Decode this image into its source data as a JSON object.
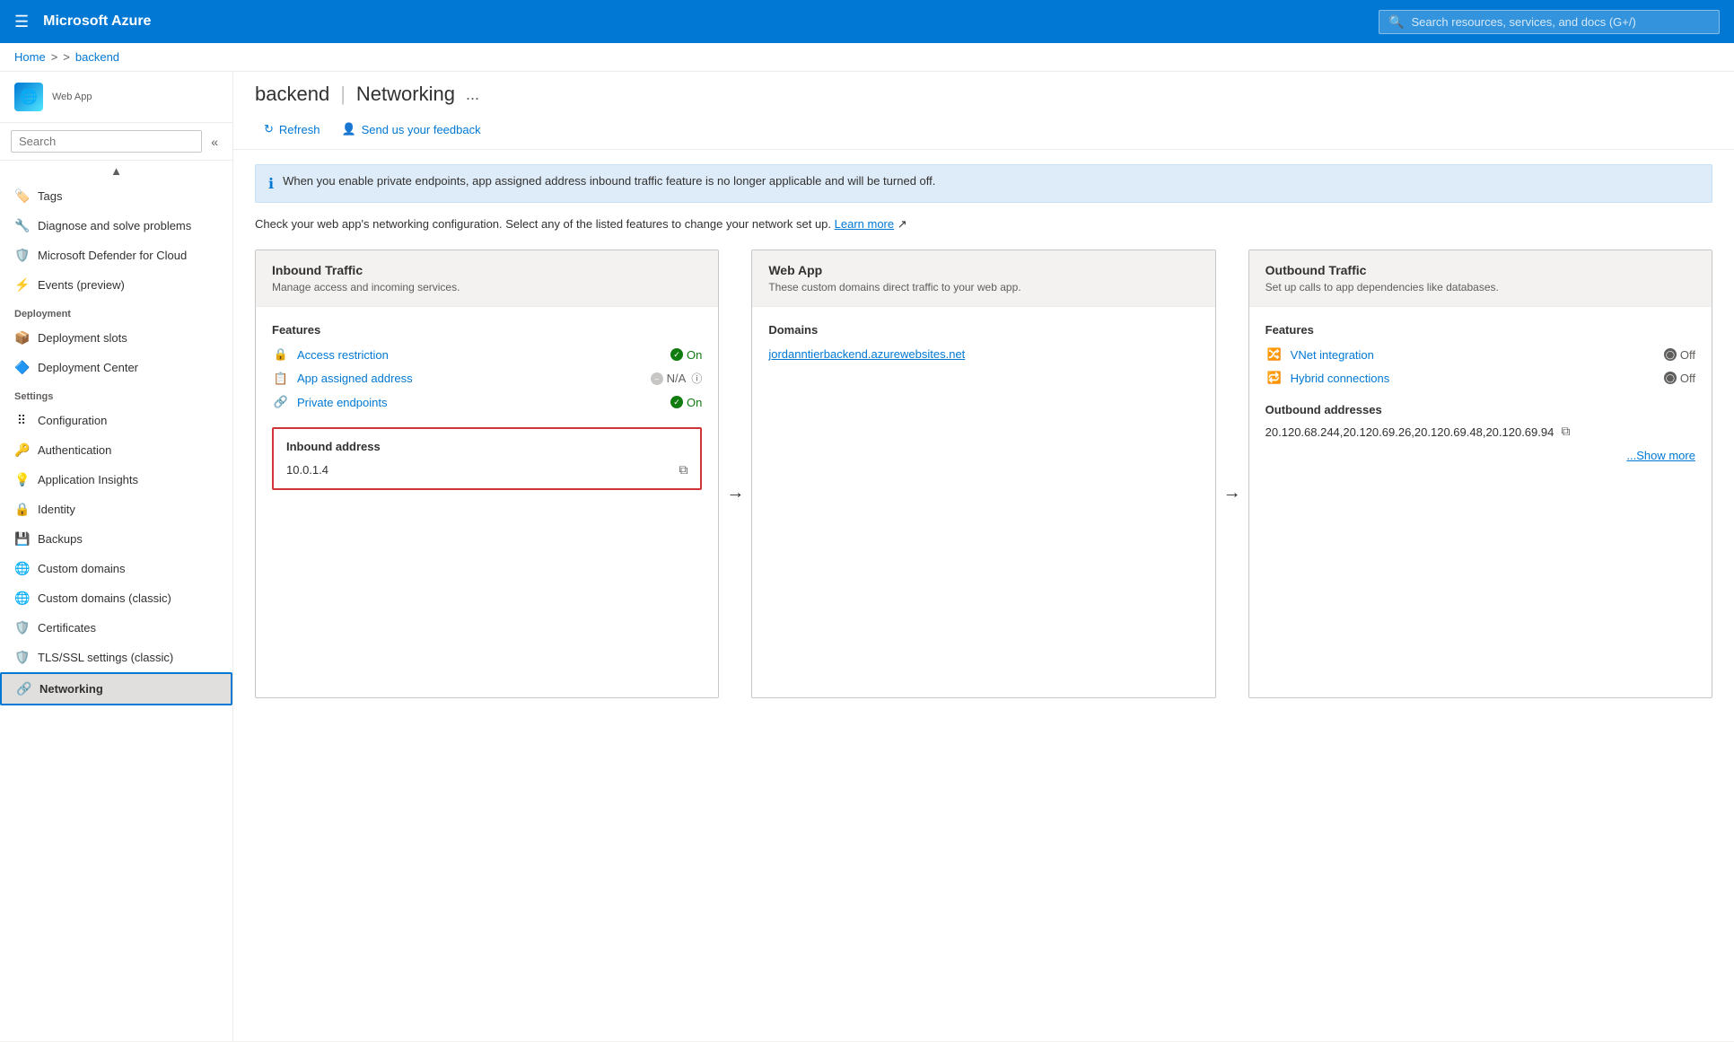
{
  "topbar": {
    "hamburger": "☰",
    "title": "Microsoft Azure",
    "search_placeholder": "Search resources, services, and docs (G+/)"
  },
  "breadcrumb": {
    "home": "Home",
    "separator1": ">",
    "separator2": ">",
    "current": "backend"
  },
  "page_header": {
    "resource_name": "backend",
    "separator": "|",
    "page_name": "Networking",
    "ellipsis": "..."
  },
  "sidebar": {
    "app_icon": "🌐",
    "app_label": "Web App",
    "search_placeholder": "Search",
    "items": [
      {
        "id": "tags",
        "label": "Tags",
        "icon": "🏷️",
        "section": null
      },
      {
        "id": "diagnose",
        "label": "Diagnose and solve problems",
        "icon": "🔧",
        "section": null
      },
      {
        "id": "defender",
        "label": "Microsoft Defender for Cloud",
        "icon": "🛡️",
        "section": null
      },
      {
        "id": "events",
        "label": "Events (preview)",
        "icon": "⚡",
        "section": null
      },
      {
        "id": "deployment-slots",
        "label": "Deployment slots",
        "icon": "📦",
        "section": "Deployment"
      },
      {
        "id": "deployment-center",
        "label": "Deployment Center",
        "icon": "🔷",
        "section": null
      },
      {
        "id": "configuration",
        "label": "Configuration",
        "icon": "⠿",
        "section": "Settings"
      },
      {
        "id": "authentication",
        "label": "Authentication",
        "icon": "🔑",
        "section": null
      },
      {
        "id": "application-insights",
        "label": "Application Insights",
        "icon": "💡",
        "section": null
      },
      {
        "id": "identity",
        "label": "Identity",
        "icon": "🔒",
        "section": null
      },
      {
        "id": "backups",
        "label": "Backups",
        "icon": "💾",
        "section": null
      },
      {
        "id": "custom-domains",
        "label": "Custom domains",
        "icon": "🌐",
        "section": null
      },
      {
        "id": "custom-domains-classic",
        "label": "Custom domains (classic)",
        "icon": "🌐",
        "section": null
      },
      {
        "id": "certificates",
        "label": "Certificates",
        "icon": "🛡️",
        "section": null
      },
      {
        "id": "tls-ssl",
        "label": "TLS/SSL settings (classic)",
        "icon": "🛡️",
        "section": null
      },
      {
        "id": "networking",
        "label": "Networking",
        "icon": "🔗",
        "section": null,
        "active": true
      }
    ]
  },
  "toolbar": {
    "refresh_label": "Refresh",
    "feedback_label": "Send us your feedback"
  },
  "info_banner": {
    "text": "When you enable private endpoints, app assigned address inbound traffic feature is no longer applicable and will be turned off."
  },
  "description": {
    "text": "Check your web app's networking configuration. Select any of the listed features to change your network set up.",
    "link_text": "Learn more"
  },
  "inbound_traffic": {
    "title": "Inbound Traffic",
    "description": "Manage access and incoming services.",
    "features_label": "Features",
    "features": [
      {
        "name": "Access restriction",
        "status": "On",
        "status_type": "on"
      },
      {
        "name": "App assigned address",
        "status": "N/A",
        "status_type": "na"
      },
      {
        "name": "Private endpoints",
        "status": "On",
        "status_type": "on"
      }
    ],
    "inbound_address_label": "Inbound address",
    "inbound_address_value": "10.0.1.4"
  },
  "web_app": {
    "title": "Web App",
    "description": "These custom domains direct traffic to your web app.",
    "domains_label": "Domains",
    "domain": "jordanntierbackend.azurewebsites.net"
  },
  "outbound_traffic": {
    "title": "Outbound Traffic",
    "description": "Set up calls to app dependencies like databases.",
    "features_label": "Features",
    "features": [
      {
        "name": "VNet integration",
        "status": "Off",
        "status_type": "off"
      },
      {
        "name": "Hybrid connections",
        "status": "Off",
        "status_type": "off"
      }
    ],
    "outbound_addresses_label": "Outbound addresses",
    "outbound_addresses": "20.120.68.244,20.120.69.26,20.120.69.48,20.120.69.94",
    "show_more": "...Show more"
  }
}
